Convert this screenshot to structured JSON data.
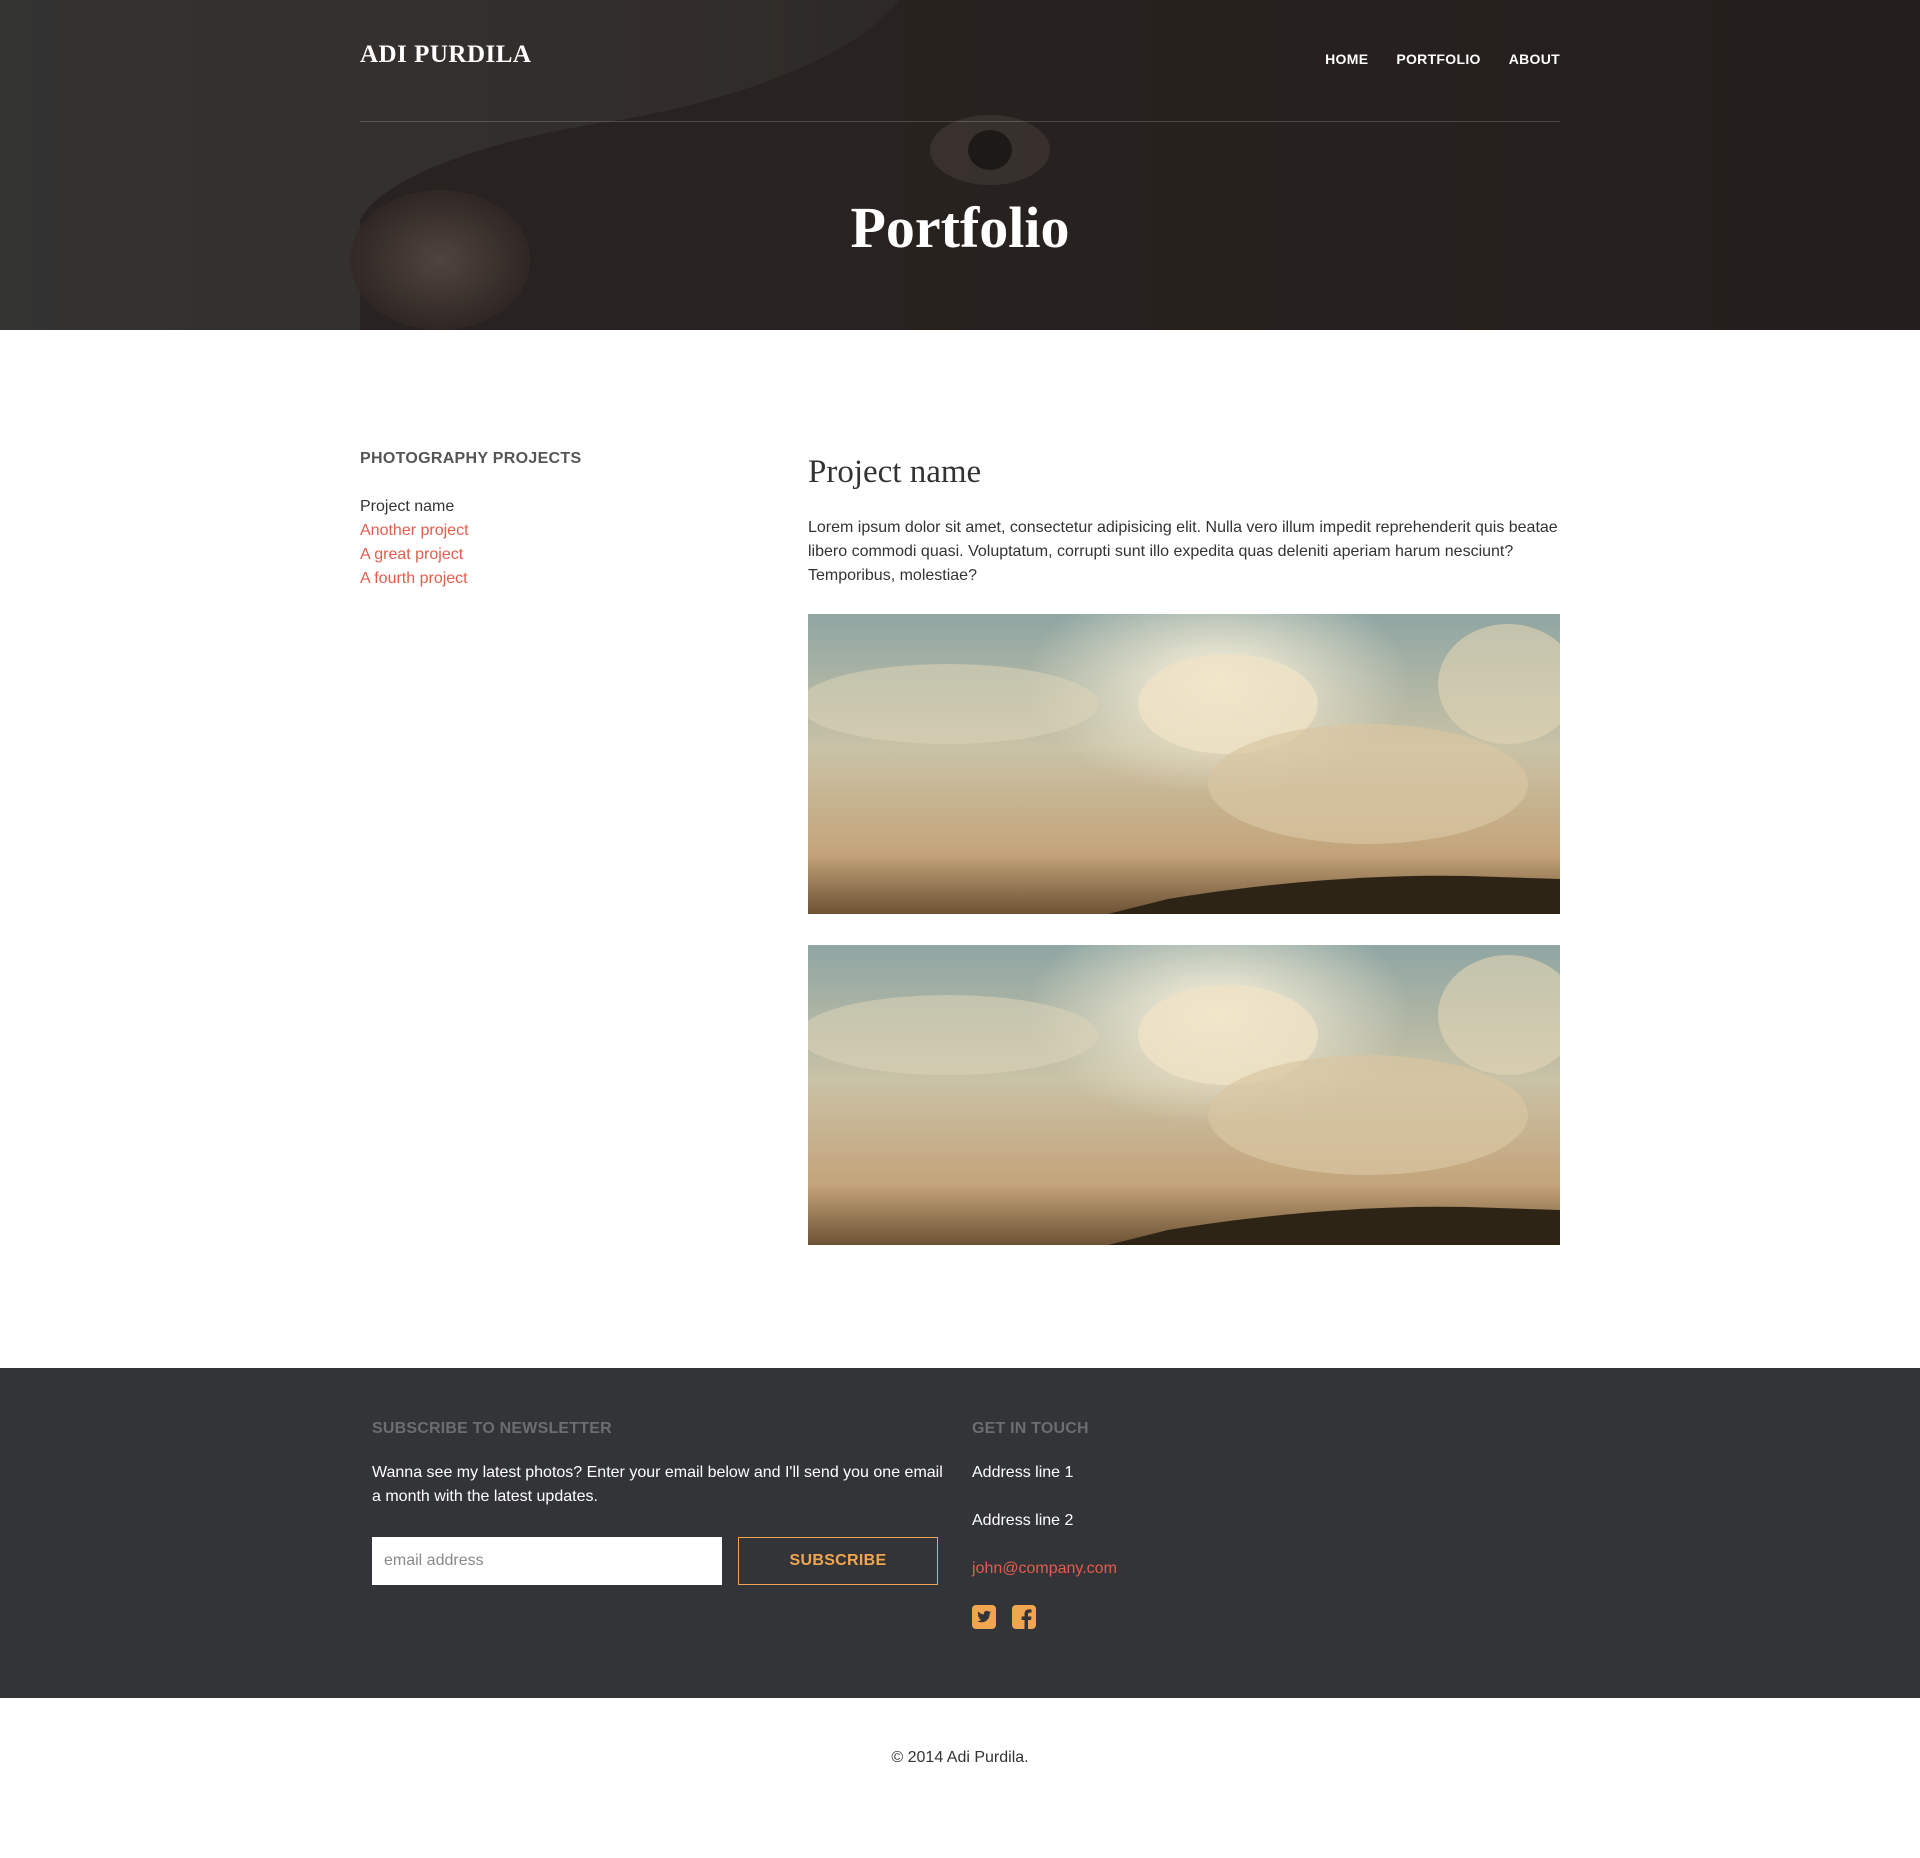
{
  "header": {
    "brand": "ADI PURDILA",
    "nav": [
      "HOME",
      "PORTFOLIO",
      "ABOUT"
    ],
    "title": "Portfolio"
  },
  "sidebar": {
    "heading": "PHOTOGRAPHY PROJECTS",
    "current": "Project name",
    "links": [
      "Another project",
      "A great project",
      "A fourth project"
    ]
  },
  "content": {
    "title": "Project name",
    "body": "Lorem ipsum dolor sit amet, consectetur adipisicing elit. Nulla vero illum impedit reprehenderit quis beatae libero commodi quasi. Voluptatum, corrupti sunt illo expedita quas deleniti aperiam harum nesciunt? Temporibus, molestiae?"
  },
  "footer": {
    "newsletter": {
      "heading": "SUBSCRIBE TO NEWSLETTER",
      "text": "Wanna see my latest photos? Enter your email below and I'll send you one email a month with the latest updates.",
      "placeholder": "email address",
      "button": "SUBSCRIBE"
    },
    "contact": {
      "heading": "GET IN TOUCH",
      "address1": "Address line 1",
      "address2": "Address line 2",
      "email": "john@company.com"
    },
    "socials": [
      "twitter-icon",
      "facebook-icon"
    ]
  },
  "copyright": "© 2014 Adi Purdila.",
  "colors": {
    "accent_link": "#e25d4d",
    "accent_button": "#f0a650",
    "footer_bg": "#333438"
  }
}
